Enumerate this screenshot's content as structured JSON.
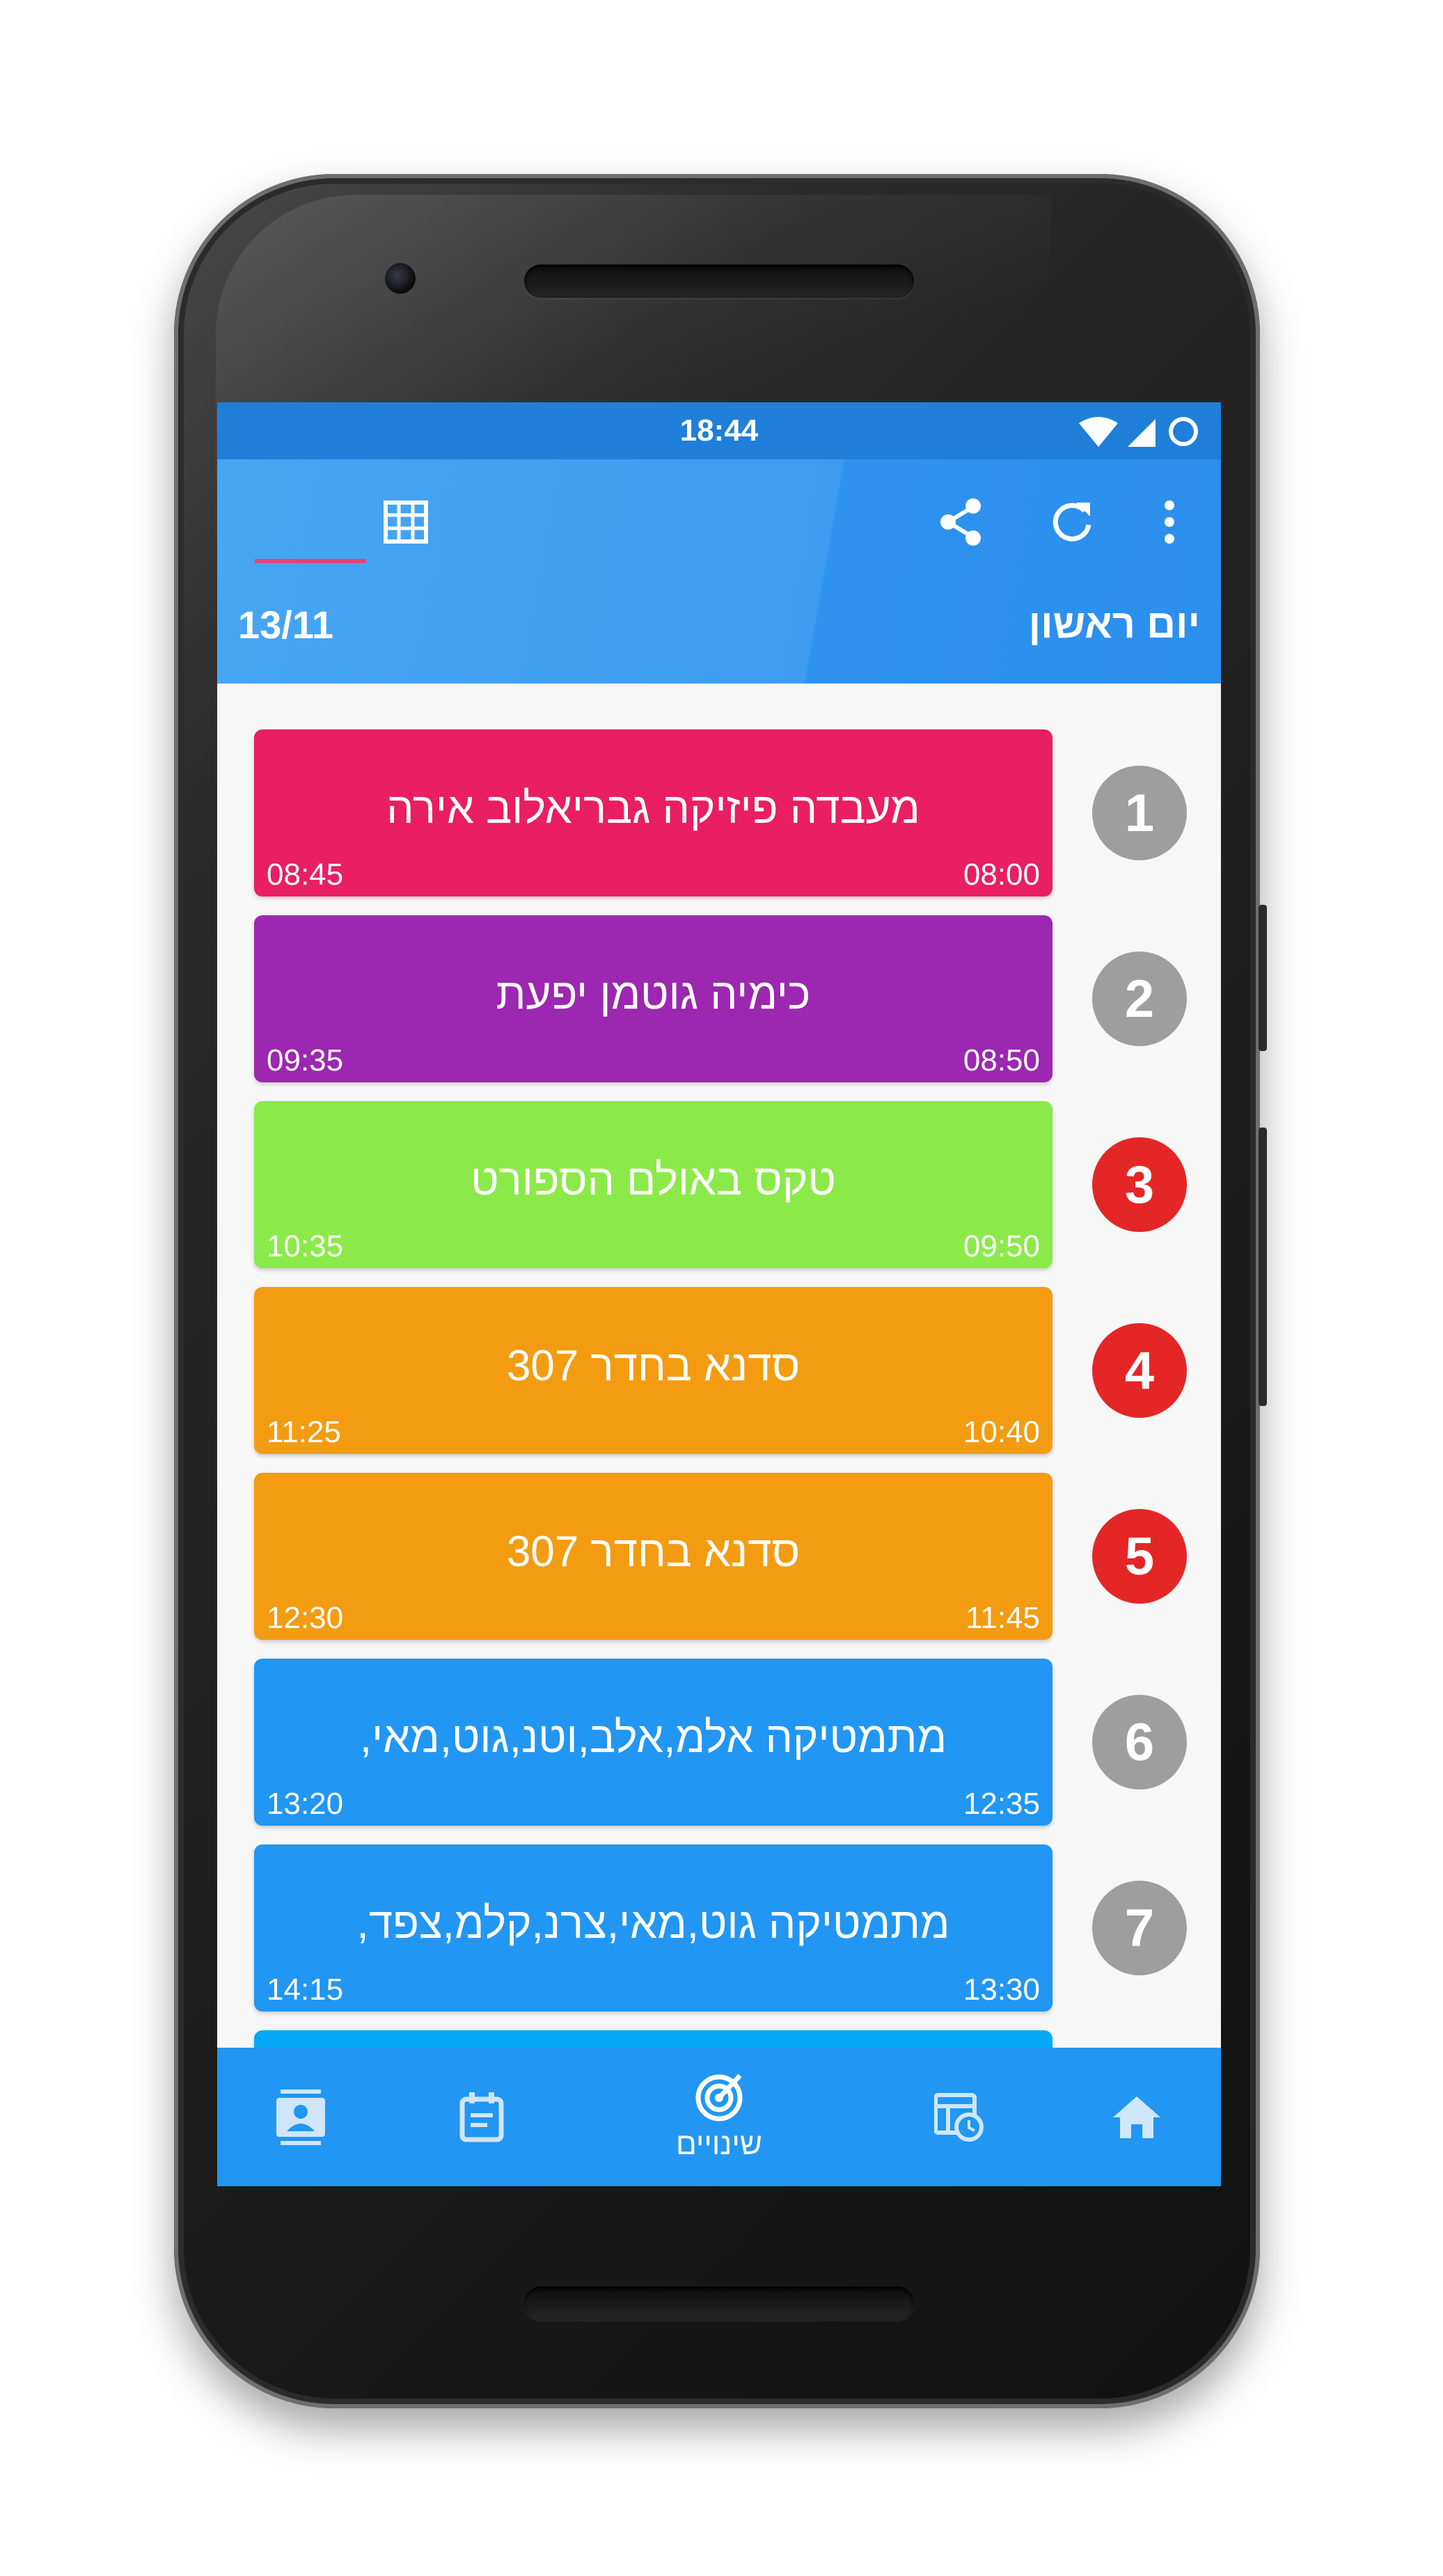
{
  "status_bar": {
    "time": "18:44"
  },
  "header": {
    "day": "יום ראשון",
    "date": "13/11"
  },
  "lessons": [
    {
      "number": "1",
      "title": "מעבדה פיזיקה גבריאלוב אירה",
      "start": "08:00",
      "end": "08:45",
      "color": "#e91e63",
      "badge_color": "#9e9e9e"
    },
    {
      "number": "2",
      "title": "כימיה גוטמן יפעת",
      "start": "08:50",
      "end": "09:35",
      "color": "#9c27b0",
      "badge_color": "#9e9e9e"
    },
    {
      "number": "3",
      "title": "טקס באולם הספורט",
      "start": "09:50",
      "end": "10:35",
      "color": "#8bea4a",
      "badge_color": "#e52626"
    },
    {
      "number": "4",
      "title": "סדנא בחדר 307",
      "start": "10:40",
      "end": "11:25",
      "color": "#f39c12",
      "badge_color": "#e52626"
    },
    {
      "number": "5",
      "title": "סדנא בחדר 307",
      "start": "11:45",
      "end": "12:30",
      "color": "#f39c12",
      "badge_color": "#e52626"
    },
    {
      "number": "6",
      "title": "מתמטיקה אלמ,אלב,וטנ,גוט,מאי,",
      "start": "12:35",
      "end": "13:20",
      "color": "#2196f3",
      "badge_color": "#9e9e9e"
    },
    {
      "number": "7",
      "title": "מתמטיקה גוט,מאי,צרנ,קלמ,צפד,",
      "start": "13:30",
      "end": "14:15",
      "color": "#2196f3",
      "badge_color": "#9e9e9e"
    }
  ],
  "bottom_nav": {
    "active_label": "שינויים"
  },
  "icons": {
    "list": "list-icon",
    "grid": "table-grid-icon",
    "share": "share-icon",
    "refresh": "refresh-icon",
    "more": "more-vert-icon",
    "contacts": "contact-card-icon",
    "calendar": "calendar-icon",
    "changes": "changes-icon",
    "schedule": "schedule-clock-icon",
    "home": "home-icon"
  }
}
